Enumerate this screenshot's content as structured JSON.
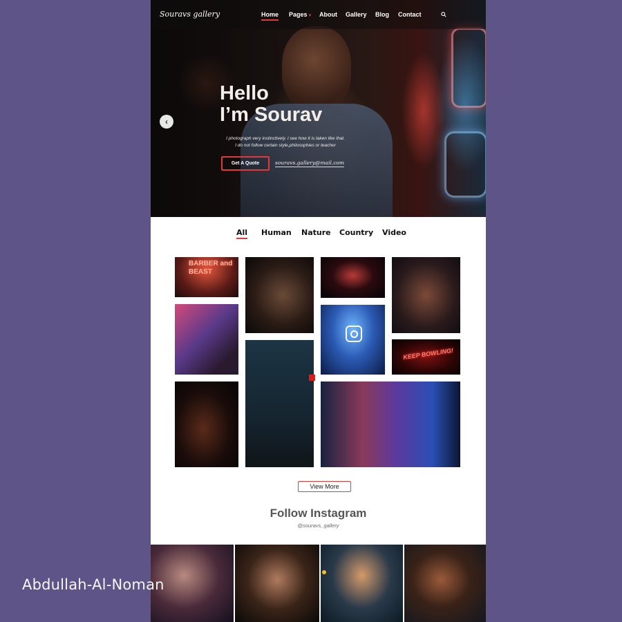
{
  "brand": "Souravs gallery",
  "nav": {
    "items": [
      {
        "label": "Home",
        "active": true
      },
      {
        "label": "Pages",
        "has_dropdown": true
      },
      {
        "label": "About"
      },
      {
        "label": "Gallery"
      },
      {
        "label": "Blog"
      },
      {
        "label": "Contact"
      }
    ],
    "search_icon": "search-icon"
  },
  "hero": {
    "title_line1": "Hello",
    "title_line2": "I’m Sourav",
    "desc_line1": "I photograph very instinctively. I see how it is taken like that.",
    "desc_line2": "I do not follow certain style,philosophies or teacher",
    "quote_button": "Get A Quote",
    "email": "souravs.gallery@mail.com",
    "prev_icon": "chevron-left-icon"
  },
  "filters": {
    "tabs": [
      "All",
      "Human",
      "Nature",
      "Country",
      "Video"
    ],
    "active": "All"
  },
  "gallery": {
    "neon_sign_1": "BARBER and BEAST",
    "neon_sign_2": "KEEP BOWLING!"
  },
  "view_more": "View More",
  "instagram": {
    "title": "Follow Instagram",
    "handle": "@souravs_gallery"
  },
  "watermark": "Abdullah-Al-Noman",
  "colors": {
    "accent": "#e03a3a",
    "background": "#5e5488"
  }
}
